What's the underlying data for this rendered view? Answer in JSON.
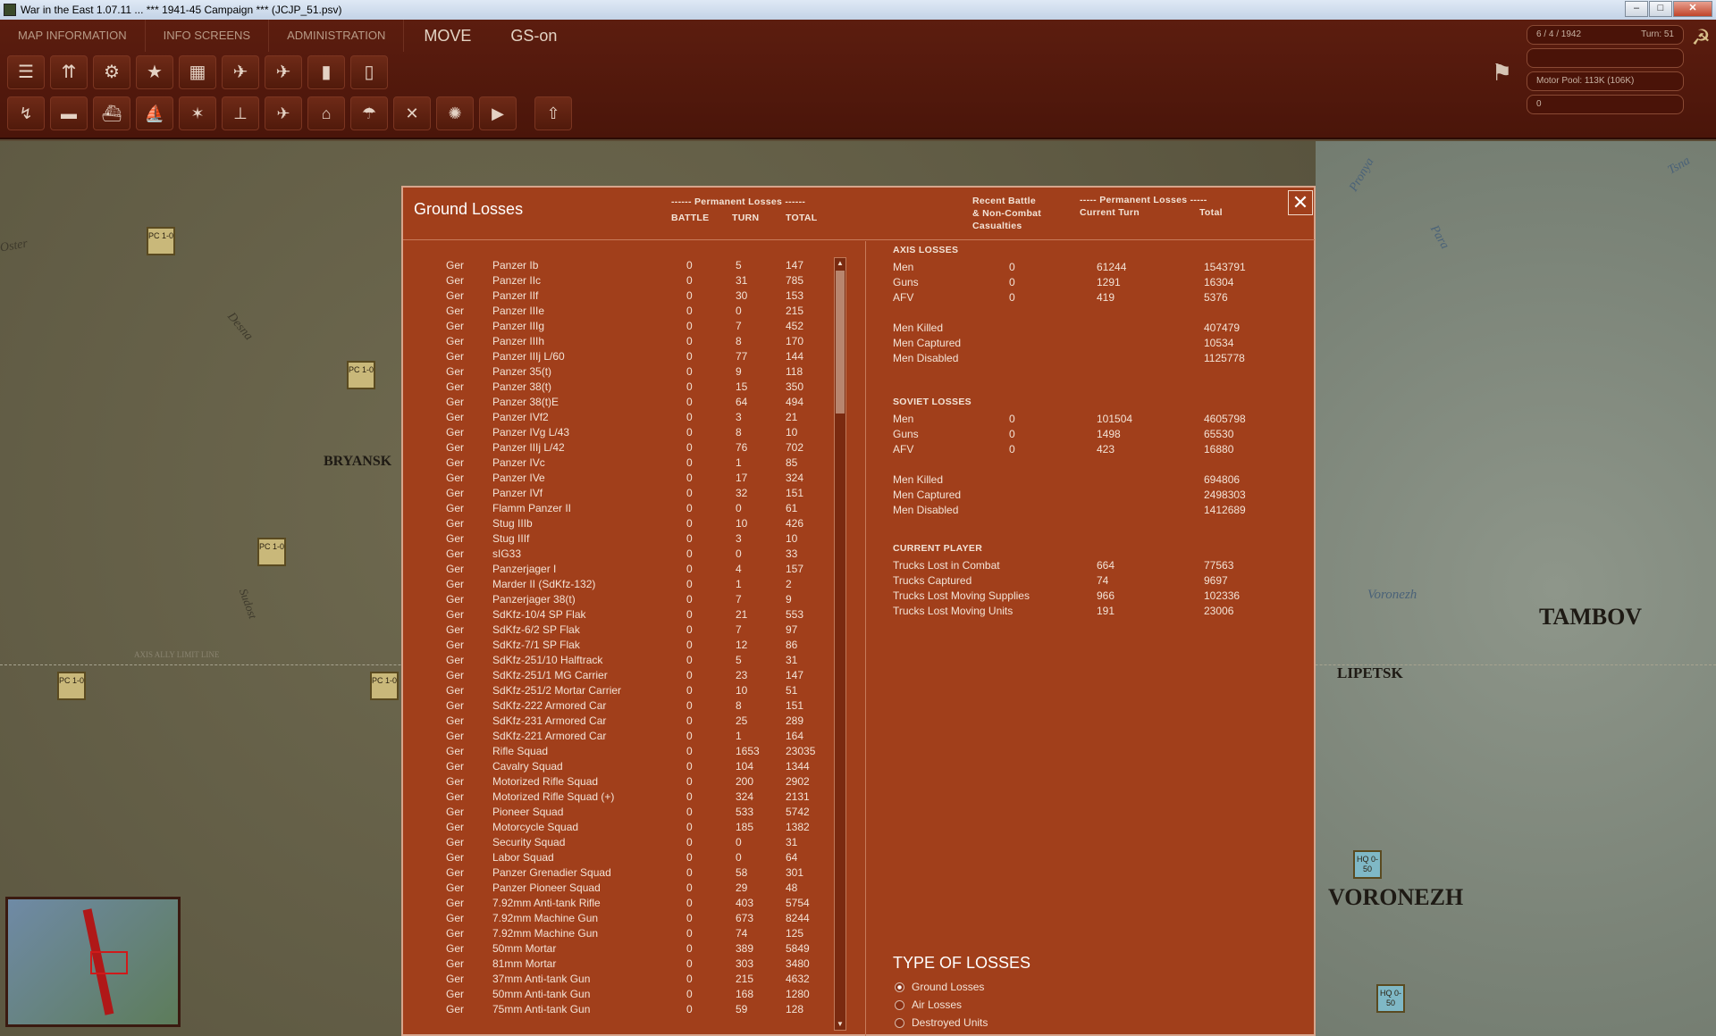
{
  "window": {
    "title": "War in the East 1.07.11 ... *** 1941-45 Campaign *** (JCJP_51.psv)"
  },
  "topbar": {
    "tabs": [
      "MAP INFORMATION",
      "INFO SCREENS",
      "ADMINISTRATION",
      "MOVE",
      "GS-on"
    ],
    "date": "6 / 4 / 1942",
    "turn": "Turn: 51",
    "motor_pool": "Motor Pool: 113K (106K)",
    "admin_points": "0"
  },
  "map": {
    "labels": [
      "BRYANSK",
      "TAMBOV",
      "LIPETSK",
      "VORONEZH",
      "Desna",
      "Pronya",
      "Para",
      "Tsna",
      "Voronezh",
      "Sudost",
      "Oster",
      "AXIS ALLY LIMIT LINE"
    ],
    "units": [
      "PC 1-0",
      "PC 1-0",
      "PC 1-0",
      "PC 1-0",
      "PC 1-0",
      "HQ 0-50",
      "HQ 0-50"
    ]
  },
  "panel": {
    "title": "Ground Losses",
    "perm_header": "------ Permanent Losses ------",
    "col_battle": "BATTLE",
    "col_turn": "TURN",
    "col_total": "TOTAL",
    "recent_header": "Recent Battle\n& Non-Combat\nCasualties",
    "perm2_header": "----- Permanent Losses -----",
    "col_current": "Current Turn",
    "col_total2": "Total",
    "rows": [
      [
        "Ger",
        "Panzer Ib",
        "0",
        "5",
        "147"
      ],
      [
        "Ger",
        "Panzer IIc",
        "0",
        "31",
        "785"
      ],
      [
        "Ger",
        "Panzer IIf",
        "0",
        "30",
        "153"
      ],
      [
        "Ger",
        "Panzer IIIe",
        "0",
        "0",
        "215"
      ],
      [
        "Ger",
        "Panzer IIIg",
        "0",
        "7",
        "452"
      ],
      [
        "Ger",
        "Panzer IIIh",
        "0",
        "8",
        "170"
      ],
      [
        "Ger",
        "Panzer IIIj L/60",
        "0",
        "77",
        "144"
      ],
      [
        "Ger",
        "Panzer 35(t)",
        "0",
        "9",
        "118"
      ],
      [
        "Ger",
        "Panzer 38(t)",
        "0",
        "15",
        "350"
      ],
      [
        "Ger",
        "Panzer 38(t)E",
        "0",
        "64",
        "494"
      ],
      [
        "Ger",
        "Panzer IVf2",
        "0",
        "3",
        "21"
      ],
      [
        "Ger",
        "Panzer IVg L/43",
        "0",
        "8",
        "10"
      ],
      [
        "Ger",
        "Panzer IIIj L/42",
        "0",
        "76",
        "702"
      ],
      [
        "Ger",
        "Panzer IVc",
        "0",
        "1",
        "85"
      ],
      [
        "Ger",
        "Panzer IVe",
        "0",
        "17",
        "324"
      ],
      [
        "Ger",
        "Panzer IVf",
        "0",
        "32",
        "151"
      ],
      [
        "Ger",
        "Flamm Panzer II",
        "0",
        "0",
        "61"
      ],
      [
        "Ger",
        "Stug IIIb",
        "0",
        "10",
        "426"
      ],
      [
        "Ger",
        "Stug IIIf",
        "0",
        "3",
        "10"
      ],
      [
        "Ger",
        "sIG33",
        "0",
        "0",
        "33"
      ],
      [
        "Ger",
        "Panzerjager I",
        "0",
        "4",
        "157"
      ],
      [
        "Ger",
        "Marder II (SdKfz-132)",
        "0",
        "1",
        "2"
      ],
      [
        "Ger",
        "Panzerjager 38(t)",
        "0",
        "7",
        "9"
      ],
      [
        "Ger",
        "SdKfz-10/4 SP Flak",
        "0",
        "21",
        "553"
      ],
      [
        "Ger",
        "SdKfz-6/2 SP Flak",
        "0",
        "7",
        "97"
      ],
      [
        "Ger",
        "SdKfz-7/1 SP Flak",
        "0",
        "12",
        "86"
      ],
      [
        "Ger",
        "SdKfz-251/10 Halftrack",
        "0",
        "5",
        "31"
      ],
      [
        "Ger",
        "SdKfz-251/1 MG Carrier",
        "0",
        "23",
        "147"
      ],
      [
        "Ger",
        "SdKfz-251/2 Mortar Carrier",
        "0",
        "10",
        "51"
      ],
      [
        "Ger",
        "SdKfz-222 Armored Car",
        "0",
        "8",
        "151"
      ],
      [
        "Ger",
        "SdKfz-231 Armored Car",
        "0",
        "25",
        "289"
      ],
      [
        "Ger",
        "SdKfz-221 Armored Car",
        "0",
        "1",
        "164"
      ],
      [
        "Ger",
        "Rifle Squad",
        "0",
        "1653",
        "23035"
      ],
      [
        "Ger",
        "Cavalry Squad",
        "0",
        "104",
        "1344"
      ],
      [
        "Ger",
        "Motorized Rifle Squad",
        "0",
        "200",
        "2902"
      ],
      [
        "Ger",
        "Motorized Rifle Squad (+)",
        "0",
        "324",
        "2131"
      ],
      [
        "Ger",
        "Pioneer Squad",
        "0",
        "533",
        "5742"
      ],
      [
        "Ger",
        "Motorcycle Squad",
        "0",
        "185",
        "1382"
      ],
      [
        "Ger",
        "Security Squad",
        "0",
        "0",
        "31"
      ],
      [
        "Ger",
        "Labor Squad",
        "0",
        "0",
        "64"
      ],
      [
        "Ger",
        "Panzer Grenadier Squad",
        "0",
        "58",
        "301"
      ],
      [
        "Ger",
        "Panzer Pioneer Squad",
        "0",
        "29",
        "48"
      ],
      [
        "Ger",
        "7.92mm Anti-tank Rifle",
        "0",
        "403",
        "5754"
      ],
      [
        "Ger",
        "7.92mm Machine Gun",
        "0",
        "673",
        "8244"
      ],
      [
        "Ger",
        "7.92mm Machine Gun",
        "0",
        "74",
        "125"
      ],
      [
        "Ger",
        "50mm Mortar",
        "0",
        "389",
        "5849"
      ],
      [
        "Ger",
        "81mm Mortar",
        "0",
        "303",
        "3480"
      ],
      [
        "Ger",
        "37mm Anti-tank Gun",
        "0",
        "215",
        "4632"
      ],
      [
        "Ger",
        "50mm Anti-tank Gun",
        "0",
        "168",
        "1280"
      ],
      [
        "Ger",
        "75mm Anti-tank Gun",
        "0",
        "59",
        "128"
      ]
    ],
    "axis": {
      "title": "AXIS LOSSES",
      "rows": [
        [
          "Men",
          "0",
          "61244",
          "1543791"
        ],
        [
          "Guns",
          "0",
          "1291",
          "16304"
        ],
        [
          "AFV",
          "0",
          "419",
          "5376"
        ]
      ],
      "killed": [
        "Men Killed",
        "407479"
      ],
      "captured": [
        "Men Captured",
        "10534"
      ],
      "disabled": [
        "Men Disabled",
        "1125778"
      ]
    },
    "soviet": {
      "title": "SOVIET LOSSES",
      "rows": [
        [
          "Men",
          "0",
          "101504",
          "4605798"
        ],
        [
          "Guns",
          "0",
          "1498",
          "65530"
        ],
        [
          "AFV",
          "0",
          "423",
          "16880"
        ]
      ],
      "killed": [
        "Men Killed",
        "694806"
      ],
      "captured": [
        "Men Captured",
        "2498303"
      ],
      "disabled": [
        "Men Disabled",
        "1412689"
      ]
    },
    "player": {
      "title": "CURRENT PLAYER",
      "rows": [
        [
          "Trucks Lost in Combat",
          "664",
          "77563"
        ],
        [
          "Trucks Captured",
          "74",
          "9697"
        ],
        [
          "Trucks Lost Moving Supplies",
          "966",
          "102336"
        ],
        [
          "Trucks Lost Moving Units",
          "191",
          "23006"
        ]
      ]
    },
    "type_title": "TYPE OF LOSSES",
    "types": [
      "Ground Losses",
      "Air Losses",
      "Destroyed Units"
    ]
  }
}
